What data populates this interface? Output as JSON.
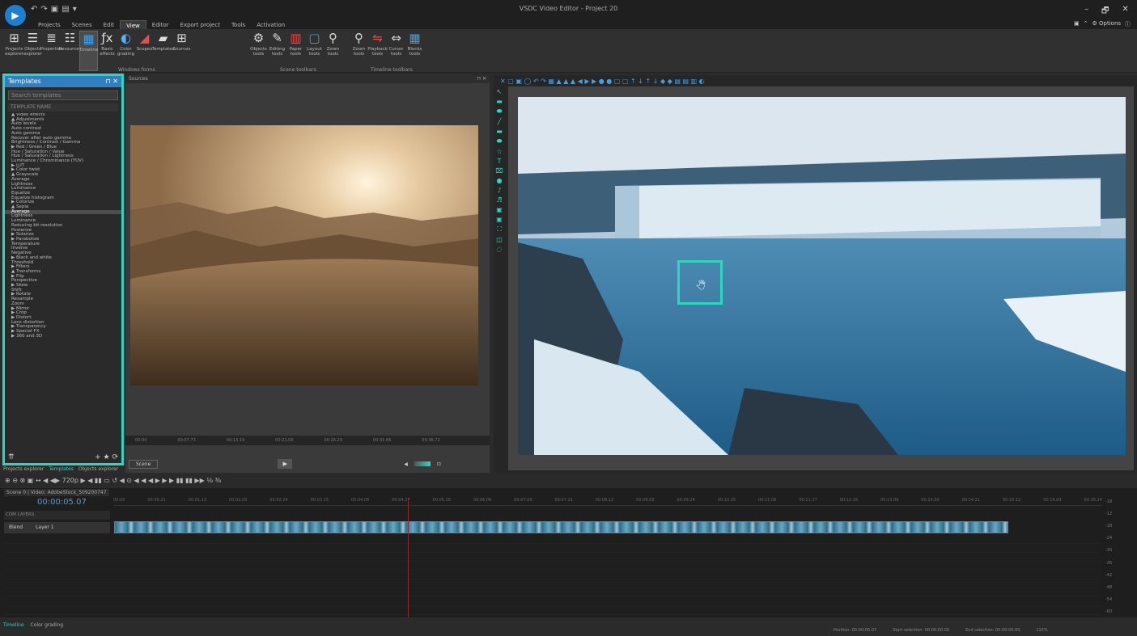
{
  "window": {
    "title": "VSDC Video Editor - Project 20",
    "controls": [
      "–",
      "🗗",
      "✕"
    ],
    "options_label": "Options"
  },
  "menu": {
    "tabs": [
      "Projects",
      "Scenes",
      "Edit",
      "View",
      "Editor",
      "Export project",
      "Tools",
      "Activation"
    ],
    "active_index": 3
  },
  "ribbon": {
    "windows_forms": {
      "label": "Windows forms",
      "buttons": [
        {
          "label": "Projects explorer",
          "icon": "tree-icon"
        },
        {
          "label": "Objects explorer",
          "icon": "list-icon"
        },
        {
          "label": "Properties",
          "icon": "properties-icon"
        },
        {
          "label": "Resources",
          "icon": "resources-icon"
        },
        {
          "label": "Timeline",
          "icon": "timeline-icon"
        },
        {
          "label": "Basic effects",
          "icon": "fx-icon"
        },
        {
          "label": "Color grading",
          "icon": "color-grading-icon"
        },
        {
          "label": "Scopes",
          "icon": "scopes-icon"
        },
        {
          "label": "Templates",
          "icon": "folder-icon"
        },
        {
          "label": "Sources",
          "icon": "sources-icon"
        }
      ]
    },
    "scene_toolbars": {
      "label": "Scene toolbars",
      "buttons": [
        {
          "label": "Objects tools",
          "icon": "gear-icon"
        },
        {
          "label": "Editing tools",
          "icon": "pen-icon"
        },
        {
          "label": "Paper tools",
          "icon": "paper-icon"
        },
        {
          "label": "Layout tools",
          "icon": "layout-icon"
        },
        {
          "label": "Zoom tools",
          "icon": "zoom-icon"
        }
      ]
    },
    "timeline_toolbars": {
      "label": "Timeline toolbars",
      "buttons": [
        {
          "label": "Zoom tools",
          "icon": "zoom-icon"
        },
        {
          "label": "Playback tools",
          "icon": "playback-icon"
        },
        {
          "label": "Cursor tools",
          "icon": "cursor-icon"
        },
        {
          "label": "Blocks tools",
          "icon": "blocks-icon"
        }
      ]
    }
  },
  "templates_panel": {
    "title": "Templates",
    "search_placeholder": "Search templates",
    "column_header": "TEMPLATE NAME",
    "items": [
      "▲ Video effects",
      "▲ Adjustments",
      "Auto levels",
      "Auto contrast",
      "Auto gamma",
      "Recover after auto gamma",
      "Brightness / Contrast / Gamma",
      "▶ Red / Green / Blue",
      "Hue / Saturation / Value",
      "Hue / Saturation / Lightness",
      "Luminance / Chrominance (YUV)",
      "▶ LUT",
      "▶ Color twist",
      "▲ Grayscale",
      "Average",
      "Lightness",
      "Luminance",
      "Equalize",
      "Equalize histogram",
      "▶ Colorize",
      "▲ Sepia",
      "Average",
      "Lightness",
      "Luminance",
      "Reducing bit resolution",
      "Posterize",
      "▶ Solarize",
      "▶ Parabolize",
      "Temperature",
      "Inverse",
      "Negative",
      "▶ Black and white",
      "Threshold",
      "▶ Filters",
      "▲ Transforms",
      "▶ Flip",
      "Perspective",
      "▶ Skew",
      "Shift",
      "▶ Rotate",
      "Resample",
      "Zoom",
      "▶ Mirror",
      "▶ Crop",
      "▶ Distort",
      "Lens distortion",
      "▶ Transparency",
      "▶ Special FX",
      "▶ 360 and 3D"
    ],
    "selected_index": 21,
    "footer_icons": [
      "⇈",
      "+",
      "★",
      "⟳"
    ]
  },
  "left_tabs": [
    "Projects explorer",
    "Templates",
    "Objects explorer"
  ],
  "sources_panel": {
    "title": "Sources",
    "ruler_ticks": [
      "00:00",
      "00:07.73",
      "00:13.19",
      "00:21.08",
      "00:26.29",
      "00:31.66",
      "00:36.72"
    ],
    "scene_label": "Scene",
    "play_symbol": "▶",
    "monitor_symbol": "⊡",
    "volume_symbol": "◀"
  },
  "editor": {
    "toolbar_icons": "✕ ▢ ▣ ◯ ↶ ↷ ▦ ▲ ▲ ▲ ◀ ▶ ▶ ● ● ▢ ▢ ↑ ↓ ↑ ↓ ◆ ◆ ▤ ▤ ▥ ◐",
    "side_tools": [
      "↖",
      "▬",
      "⬬",
      "╱",
      "▬",
      "⬬",
      "☆",
      "T",
      "⌧",
      "●",
      "♪",
      "♬",
      "▣",
      "▣",
      "⛶",
      "◫",
      "◌"
    ],
    "cursor_symbol": "🖑"
  },
  "timeline": {
    "scene_tab": "Scene 0",
    "clip_tab": "Video: AdobeStock_509200747",
    "timecode": "00:00:05.07",
    "toolbar": "⊕ ⊖ ⊗ ▣ ↔ ◀ ◀▶ 720p ▶ ◀ ▮▮ ▭ ↺ ◀ ⊙ ◀ ◀ ◀ ▶ ▶ ▶ ▮▮ ▮▮ ▶▶ ⅛ ⅜",
    "comp_label": "COM  LAYERS",
    "blend_label": "Blend",
    "layer_name": "Layer 1",
    "ruler": [
      "00:00",
      "00:00.21",
      "00:01.13",
      "00:02.03",
      "00:02.24",
      "00:03.15",
      "00:04.06",
      "00:04.27",
      "00:05.18",
      "00:06.09",
      "00:07.00",
      "00:07.21",
      "00:08.12",
      "00:09.03",
      "00:09.24",
      "00:10.15",
      "00:11.06",
      "00:11.27",
      "00:12.18",
      "00:13.09",
      "00:14.00",
      "00:14.21",
      "00:15.12",
      "00:16.03",
      "00:16.24"
    ],
    "vu_scale": [
      "-18",
      "-12",
      "-18",
      "-24",
      "-30",
      "-36",
      "-42",
      "-48",
      "-54",
      "-60"
    ]
  },
  "bottom_tabs": [
    "Timeline",
    "Color grading"
  ],
  "status": [
    "Position: 00:00:05.07",
    "Start selection: 00:00:00.00",
    "End selection: 00:00:00.00",
    "115%"
  ],
  "colors": {
    "accent": "#2fd6bf",
    "brand": "#1d7fd4",
    "panel_header": "#2f7fc1"
  }
}
